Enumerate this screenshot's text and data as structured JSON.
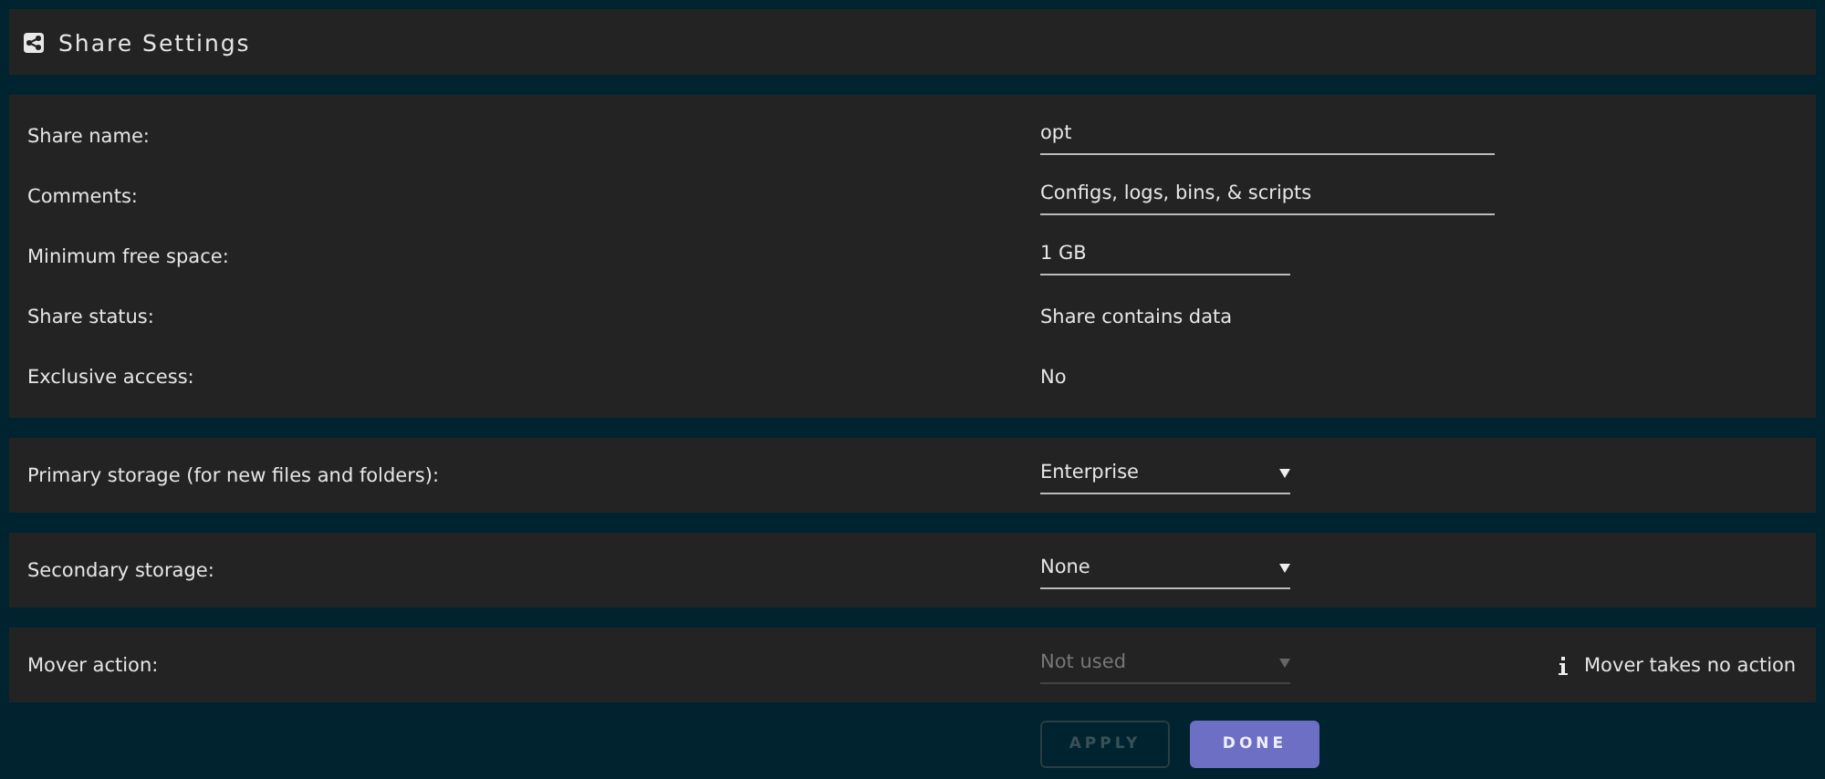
{
  "header": {
    "title": "Share Settings"
  },
  "sections": [
    {
      "rows": [
        {
          "label": "Share name:",
          "kind": "input",
          "value": "opt"
        },
        {
          "label": "Comments:",
          "kind": "input",
          "value": "Configs, logs, bins, & scripts"
        },
        {
          "label": "Minimum free space:",
          "kind": "size-input",
          "value": "1 GB"
        },
        {
          "label": "Share status:",
          "kind": "text",
          "value": "Share contains data"
        },
        {
          "label": "Exclusive access:",
          "kind": "text",
          "value": "No"
        }
      ]
    },
    {
      "rows": [
        {
          "label": "Primary storage (for new files and folders):",
          "kind": "select",
          "value": "Enterprise",
          "disabled": false
        }
      ]
    },
    {
      "rows": [
        {
          "label": "Secondary storage:",
          "kind": "select",
          "value": "None",
          "disabled": false
        }
      ]
    },
    {
      "rows": [
        {
          "label": "Mover action:",
          "kind": "select",
          "value": "Not used",
          "disabled": true,
          "note": "Mover takes no action"
        }
      ]
    }
  ],
  "buttons": [
    {
      "label": "APPLY",
      "disabled": true
    },
    {
      "label": "DONE",
      "disabled": false
    }
  ]
}
